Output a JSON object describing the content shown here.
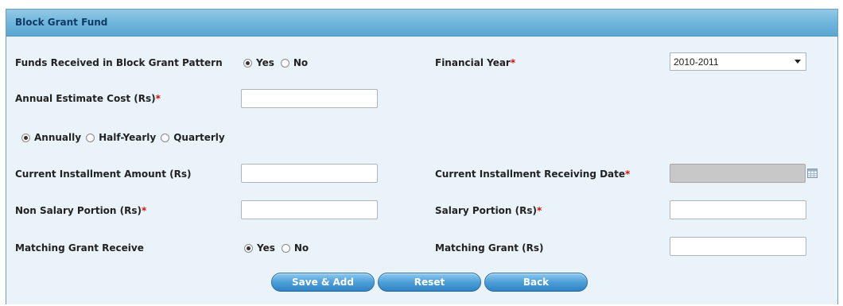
{
  "panel": {
    "title": "Block Grant Fund"
  },
  "form": {
    "funds_received": {
      "label": "Funds Received in Block Grant Pattern",
      "options": [
        "Yes",
        "No"
      ],
      "selected": "Yes"
    },
    "financial_year": {
      "label": "Financial Year",
      "required_mark": "*",
      "value": "2010-2011"
    },
    "annual_estimate": {
      "label": "Annual Estimate Cost (Rs)",
      "required_mark": "*",
      "value": ""
    },
    "frequency": {
      "options": [
        "Annually",
        "Half-Yearly",
        "Quarterly"
      ],
      "selected": "Annually"
    },
    "current_installment_amount": {
      "label": "Current Installment Amount (Rs)",
      "value": ""
    },
    "current_installment_date": {
      "label": "Current Installment Receiving Date",
      "required_mark": "*",
      "value": "",
      "icon": "calendar-icon"
    },
    "non_salary_portion": {
      "label": "Non Salary Portion (Rs)",
      "required_mark": "*",
      "value": ""
    },
    "salary_portion": {
      "label": "Salary Portion (Rs)",
      "required_mark": "*",
      "value": ""
    },
    "matching_grant_receive": {
      "label": "Matching Grant Receive",
      "options": [
        "Yes",
        "No"
      ],
      "selected": "Yes"
    },
    "matching_grant": {
      "label": "Matching Grant (Rs)",
      "value": ""
    }
  },
  "buttons": {
    "save_add": "Save & Add",
    "reset": "Reset",
    "back": "Back"
  },
  "colors": {
    "header": "#6db4dc",
    "panel_bg": "#e9f3f9",
    "required": "#d01010",
    "button": "#4d9fd8"
  }
}
